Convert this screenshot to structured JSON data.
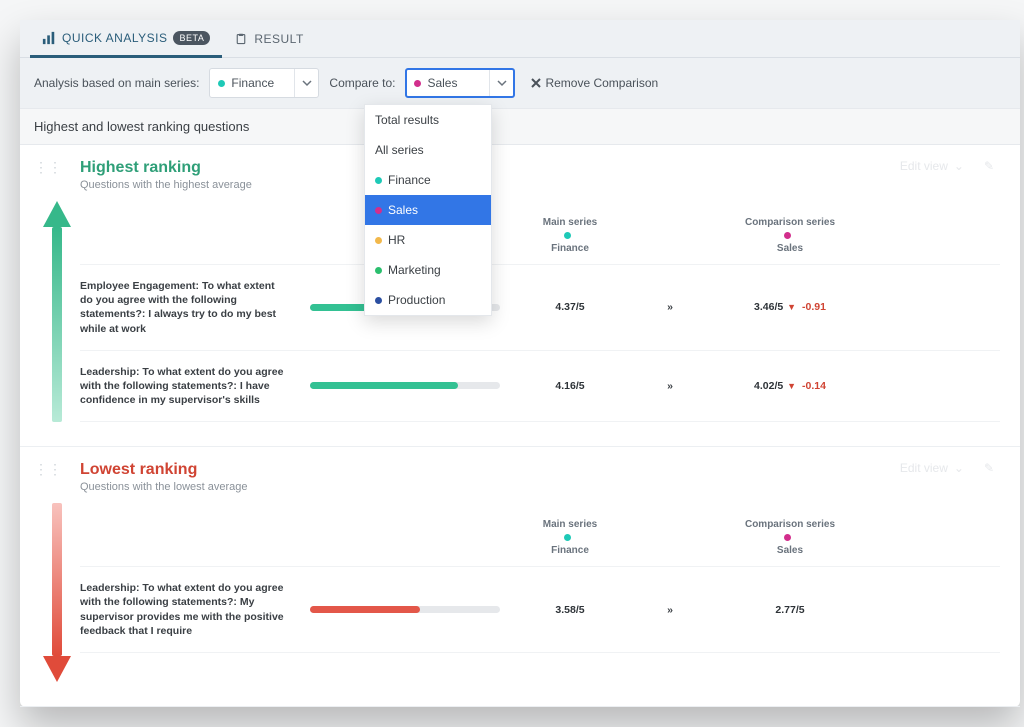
{
  "colors": {
    "accent": "#2a5d7a",
    "green": "#33c193",
    "red": "#e35749",
    "blue": "#3276e6",
    "finance": "#1ec9b7",
    "sales": "#d22e8c",
    "hr": "#f2b84b",
    "marketing": "#2bbf6e",
    "production": "#2b4fa1"
  },
  "tabs": {
    "quick_analysis": {
      "label": "QUICK ANALYSIS",
      "badge": "BETA",
      "active": true
    },
    "result": {
      "label": "RESULT",
      "active": false
    }
  },
  "filterbar": {
    "main_label": "Analysis based on main series:",
    "main_series": {
      "name": "Finance",
      "dot": "finance"
    },
    "compare_label": "Compare to:",
    "compare_series": {
      "name": "Sales",
      "dot": "sales"
    },
    "remove_label": "Remove Comparison"
  },
  "dropdown": {
    "items": [
      {
        "label": "Total results",
        "dot": null,
        "selected": false
      },
      {
        "label": "All series",
        "dot": null,
        "selected": false
      },
      {
        "label": "Finance",
        "dot": "finance",
        "selected": false
      },
      {
        "label": "Sales",
        "dot": "sales",
        "selected": true
      },
      {
        "label": "HR",
        "dot": "hr",
        "selected": false
      },
      {
        "label": "Marketing",
        "dot": "marketing",
        "selected": false
      },
      {
        "label": "Production",
        "dot": "production",
        "selected": false
      }
    ]
  },
  "section_title": "Highest and lowest ranking questions",
  "edit_view_label": "Edit view",
  "columns": {
    "main_title": "Main series",
    "main_value": "Finance",
    "comp_title": "Comparison series",
    "comp_value": "Sales"
  },
  "panels": {
    "high": {
      "title": "Highest ranking",
      "subtitle": "Questions with the highest average",
      "rows": [
        {
          "question": "Employee Engagement: To what extent do you agree with the following statements?: I always try to do my best while at work",
          "bar_percent": 80,
          "bar_color": "green",
          "value": "4.37/5",
          "comp_value": "3.46/5",
          "comp_delta": "-0.91"
        },
        {
          "question": "Leadership: To what extent do you agree with the following statements?: I have confidence in my supervisor's skills",
          "bar_percent": 78,
          "bar_color": "green",
          "value": "4.16/5",
          "comp_value": "4.02/5",
          "comp_delta": "-0.14"
        }
      ]
    },
    "low": {
      "title": "Lowest ranking",
      "subtitle": "Questions with the lowest average",
      "rows": [
        {
          "question": "Leadership: To what extent do you agree with the following statements?: My supervisor provides me with the positive feedback that I require",
          "bar_percent": 58,
          "bar_color": "red",
          "value": "3.58/5",
          "comp_value": "2.77/5",
          "comp_delta": ""
        }
      ]
    }
  }
}
